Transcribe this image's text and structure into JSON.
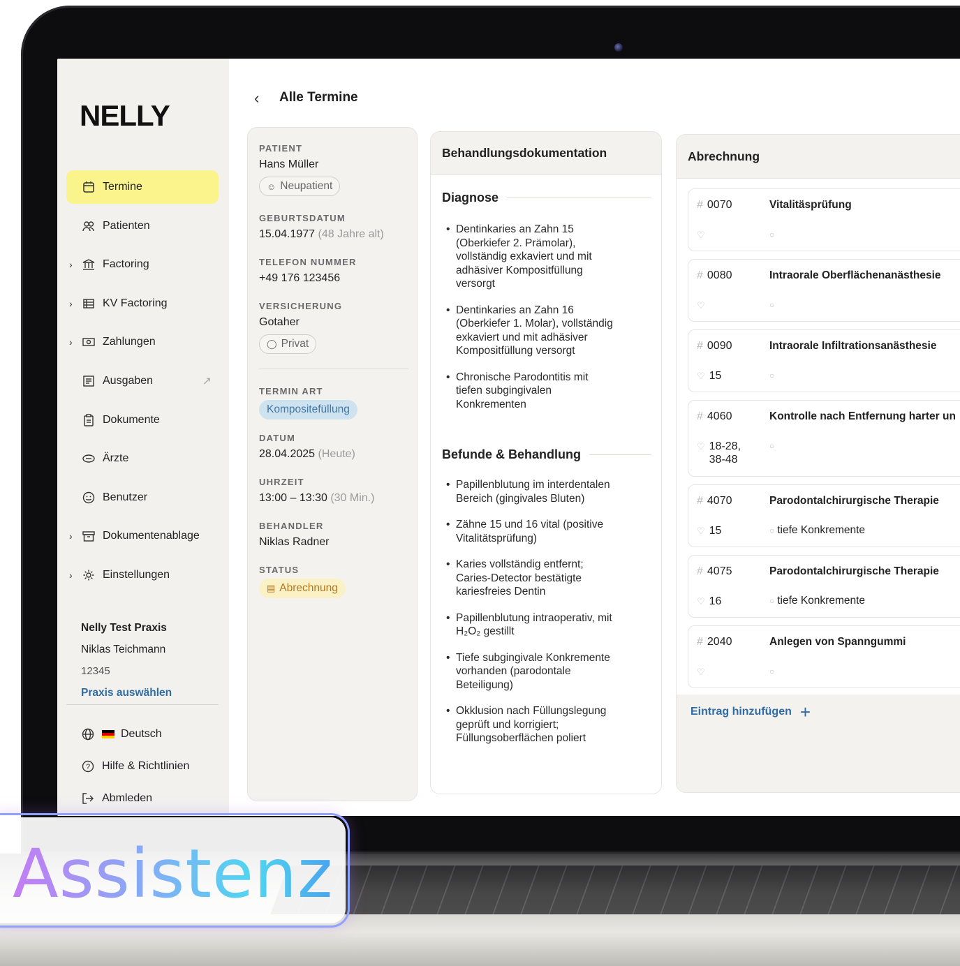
{
  "logo": "NELLY",
  "header": {
    "back_icon": "chevron-left-icon",
    "title": "Alle Termine"
  },
  "sidebar": {
    "items": [
      {
        "label": "Termine",
        "icon": "calendar-icon",
        "chevron": false
      },
      {
        "label": "Patienten",
        "icon": "users-icon",
        "chevron": false
      },
      {
        "label": "Factoring",
        "icon": "bank-icon",
        "chevron": true
      },
      {
        "label": "KV Factoring",
        "icon": "table-icon",
        "chevron": true
      },
      {
        "label": "Zahlungen",
        "icon": "cash-icon",
        "chevron": true
      },
      {
        "label": "Ausgaben",
        "icon": "receipt-icon",
        "chevron": false
      },
      {
        "label": "Dokumente",
        "icon": "clipboard-icon",
        "chevron": false
      },
      {
        "label": "Ärzte",
        "icon": "doctor-icon",
        "chevron": false
      },
      {
        "label": "Benutzer",
        "icon": "smiley-icon",
        "chevron": false
      },
      {
        "label": "Dokumentenablage",
        "icon": "archive-icon",
        "chevron": true
      },
      {
        "label": "Einstellungen",
        "icon": "gear-icon",
        "chevron": true
      }
    ],
    "practice": {
      "name": "Nelly Test Praxis",
      "user": "Niklas Teichmann",
      "id": "12345",
      "switch_link": "Praxis auswählen"
    },
    "footer": {
      "language": "Deutsch",
      "help": "Hilfe & Richtlinien",
      "logout": "Abmleden"
    }
  },
  "patient": {
    "patient_label": "PATIENT",
    "name": "Hans Müller",
    "status_chip": "Neupatient",
    "birth_label": "GEBURTSDATUM",
    "birth_date": "15.04.1977",
    "birth_age": "(48 Jahre alt)",
    "phone_label": "TELEFON NUMMER",
    "phone": "+49 176 123456",
    "insurance_label": "VERSICHERUNG",
    "insurance": "Gotaher",
    "insurance_type": "Privat",
    "type_label": "TERMIN ART",
    "type": "Kompositefüllung",
    "date_label": "DATUM",
    "date": "28.04.2025",
    "date_note": "(Heute)",
    "time_label": "UHRZEIT",
    "time": "13:00 – 13:30",
    "time_note": "(30 Min.)",
    "practitioner_label": "BEHANDLER",
    "practitioner": "Niklas Radner",
    "status_label": "STATUS",
    "status": "Abrechnung"
  },
  "documentation": {
    "title": "Behandlungsdokumentation",
    "diagnosis_title": "Diagnose",
    "diagnosis": [
      "Dentinkaries an Zahn 15 (Oberkiefer 2. Prämolar), vollständig exkaviert und mit adhäsiver Kompositfüllung versorgt",
      "Dentinkaries an Zahn 16 (Oberkiefer 1. Molar), vollständig exkaviert und mit adhäsiver Kompositfüllung versorgt",
      "Chronische Parodontitis mit tiefen subgingivalen Konkrementen"
    ],
    "findings_title": "Befunde & Behandlung",
    "findings": [
      "Papillenblutung im interdentalen Bereich (gingivales Bluten)",
      "Zähne 15 und 16 vital (positive Vitalitätsprüfung)",
      "Karies vollständig entfernt; Caries-Detector bestätigte kariesfreies Dentin",
      "Papillenblutung intraoperativ, mit H₂O₂ gestillt",
      "Tiefe subgingivale Konkremente vorhanden (parodontale Beteiligung)",
      "Okklusion nach Füllungslegung geprüft und korrigiert; Füllungsoberflächen poliert"
    ]
  },
  "billing": {
    "title": "Abrechnung",
    "entries": [
      {
        "code": "0070",
        "title": "Vitalitäsprüfung",
        "tooth": "",
        "note": ""
      },
      {
        "code": "0080",
        "title": "Intraorale Oberflächenanästhesie",
        "tooth": "",
        "note": ""
      },
      {
        "code": "0090",
        "title": "Intraorale Infiltrationsanästhesie",
        "tooth": "15",
        "note": ""
      },
      {
        "code": "4060",
        "title": "Kontrolle nach Entfernung harter un",
        "tooth": "18-28,\n38-48",
        "note": ""
      },
      {
        "code": "4070",
        "title": "Parodontalchirurgische Therapie",
        "tooth": "15",
        "note": "tiefe Konkremente"
      },
      {
        "code": "4075",
        "title": "Parodontalchirurgische Therapie",
        "tooth": "16",
        "note": "tiefe Konkremente"
      },
      {
        "code": "2040",
        "title": "Anlegen von Spanngummi",
        "tooth": "",
        "note": ""
      }
    ],
    "add_label": "Eintrag hinzufügen"
  },
  "badge": "Assistenz"
}
